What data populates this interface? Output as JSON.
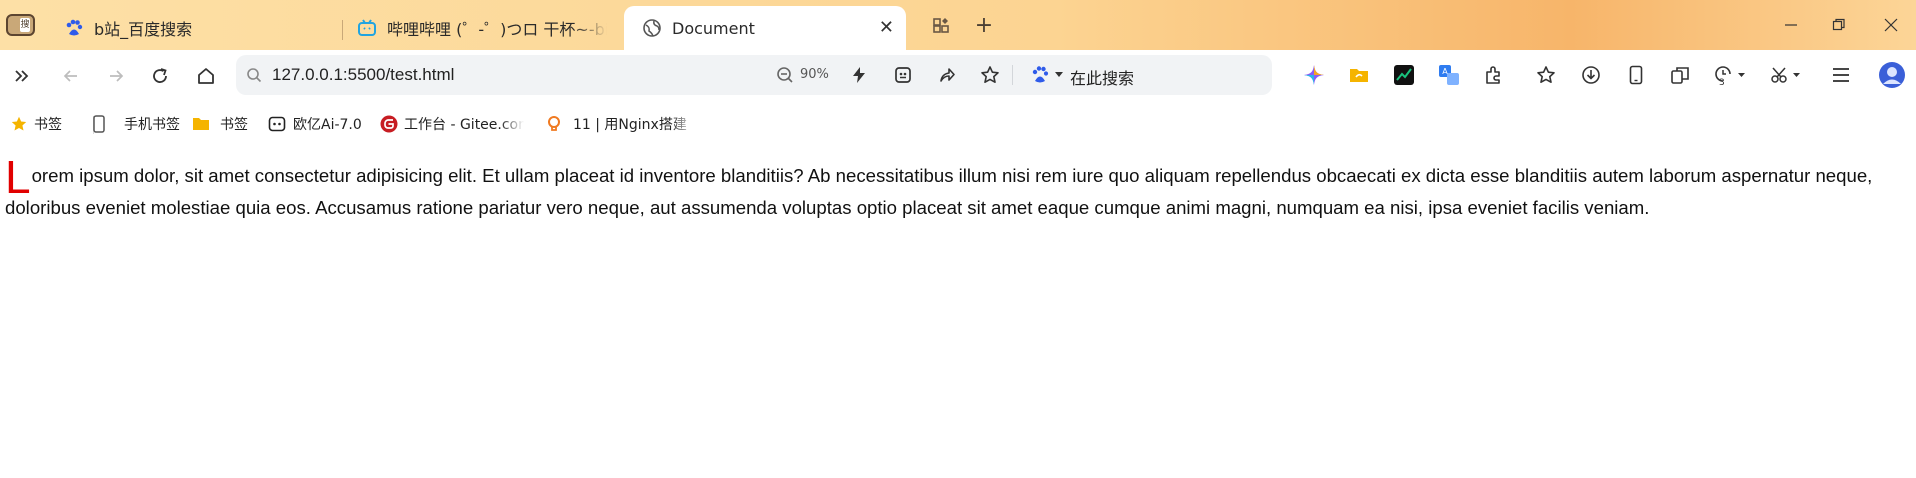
{
  "browser": {
    "sidebar_toggle_glyph": "搜",
    "tabs": [
      {
        "label": "b站_百度搜索",
        "icon": "baidu-paw-icon",
        "active": false
      },
      {
        "label": "哔哩哔哩 (゜-゜)つロ 干杯~-bilibili",
        "icon": "bilibili-tv-icon",
        "active": false
      },
      {
        "label": "Document",
        "icon": "globe-icon",
        "active": true
      }
    ],
    "new_tab_label": "+",
    "window_controls": [
      "minimize-icon",
      "restore-icon",
      "close-icon"
    ]
  },
  "toolbar": {
    "url": "127.0.0.1:5500/test.html",
    "zoom": "90%",
    "search_placeholder": "在此搜索",
    "accent_color": "#2f5bea"
  },
  "bookmarks": [
    {
      "label": "书签",
      "icon": "star-icon"
    },
    {
      "label": "手机书签",
      "icon": "phone-icon"
    },
    {
      "label": "书签",
      "icon": "folder-icon"
    },
    {
      "label": "欧亿Ai-7.0",
      "icon": "chatbot-icon"
    },
    {
      "label": "工作台 - Gitee.com",
      "icon": "gitee-icon"
    },
    {
      "label": "11 | 用Nginx搭建",
      "icon": "bulb-icon"
    }
  ],
  "page": {
    "dropcap": "L",
    "dropcap_color": "#e10000",
    "paragraph": "orem ipsum dolor, sit amet consectetur adipisicing elit. Et ullam placeat id inventore blanditiis? Ab necessitatibus illum nisi rem iure quo aliquam repellendus obcaecati ex dicta esse blanditiis autem laborum aspernatur neque, doloribus eveniet molestiae quia eos. Accusamus ratione pariatur vero neque, aut assumenda voluptas optio placeat sit amet eaque cumque animi magni, numquam ea nisi, ipsa eveniet facilis veniam."
  }
}
